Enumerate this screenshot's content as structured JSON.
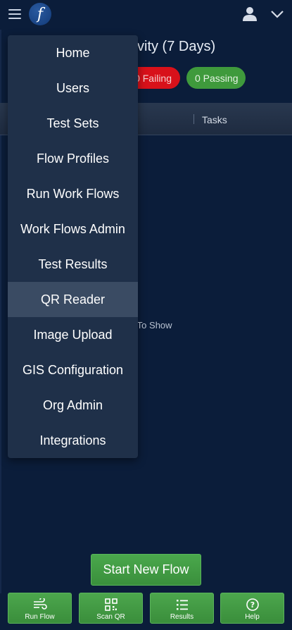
{
  "header": {
    "logo_letter": "f",
    "icons": [
      "menu-icon",
      "logo-icon",
      "user-icon",
      "chevron-down-icon"
    ]
  },
  "main": {
    "title": "tivity (7 Days)",
    "failing_label": "0 Failing",
    "passing_label": "0 Passing",
    "table_header_tasks": "Tasks",
    "empty_text": "ws To Show"
  },
  "menu": {
    "items": [
      {
        "label": "Home"
      },
      {
        "label": "Users"
      },
      {
        "label": "Test Sets"
      },
      {
        "label": "Flow Profiles"
      },
      {
        "label": "Run Work Flows"
      },
      {
        "label": "Work Flows Admin"
      },
      {
        "label": "Test Results"
      },
      {
        "label": "QR Reader",
        "active": true
      },
      {
        "label": "Image Upload"
      },
      {
        "label": "GIS Configuration"
      },
      {
        "label": "Org Admin"
      },
      {
        "label": "Integrations"
      }
    ]
  },
  "actions": {
    "start_new_flow": "Start New Flow"
  },
  "bottom_nav": {
    "items": [
      {
        "label": "Run Flow",
        "icon": "wind-icon"
      },
      {
        "label": "Scan QR",
        "icon": "qr-code-icon"
      },
      {
        "label": "Results",
        "icon": "list-icon"
      },
      {
        "label": "Help",
        "icon": "help-icon"
      }
    ]
  },
  "colors": {
    "background": "#0b1d3a",
    "menu_background": "#1f3049",
    "menu_active": "#3a4b63",
    "failing": "#d8111a",
    "passing": "#3f9a3c",
    "button_green": "#4aa84c"
  }
}
